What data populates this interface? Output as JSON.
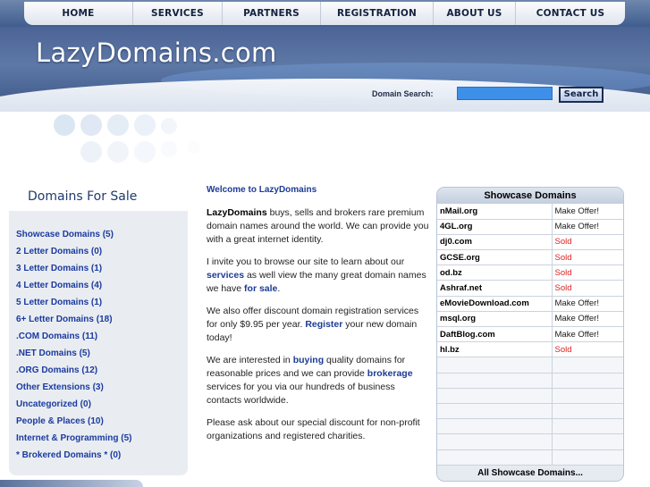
{
  "nav": {
    "items": [
      "HOME",
      "SERVICES",
      "PARTNERS",
      "REGISTRATION",
      "ABOUT US",
      "CONTACT US"
    ]
  },
  "header": {
    "logo": "LazyDomains.com",
    "search_label": "Domain Search:",
    "search_value": "",
    "search_button": "Search"
  },
  "sidebar": {
    "title": "Domains For Sale",
    "items": [
      "Showcase Domains (5)",
      "2 Letter Domains (0)",
      "3 Letter Domains (1)",
      "4 Letter Domains (4)",
      "5 Letter Domains (1)",
      "6+ Letter Domains (18)",
      ".COM Domains (11)",
      ".NET Domains (5)",
      ".ORG Domains (12)",
      "Other Extensions (3)",
      "Uncategorized (0)",
      "People & Places (10)",
      "Internet & Programming (5)",
      "* Brokered Domains * (0)"
    ]
  },
  "content": {
    "welcome": "Welcome to LazyDomains",
    "p1_bold": "LazyDomains",
    "p1_text": " buys, sells and brokers rare premium domain names around the world. We can provide you with a great internet identity.",
    "p2_a": "I invite you to browse our site to learn about our ",
    "p2_link1": "services",
    "p2_b": " as well view the many great domain names we have ",
    "p2_link2": "for sale",
    "p2_c": ".",
    "p3_a": "We also offer discount domain registration services for only $9.95 per year. ",
    "p3_link": "Register",
    "p3_b": " your new domain today!",
    "p4_a": "We are interested in ",
    "p4_link1": "buying",
    "p4_b": " quality domains for reasonable prices and we can provide ",
    "p4_link2": "brokerage",
    "p4_c": " services for you via our hundreds of business contacts worldwide.",
    "p5": "Please ask about our special discount for non-profit organizations and registered charities."
  },
  "showcase": {
    "title": "Showcase Domains",
    "rows": [
      {
        "name": "nMail.org",
        "status": "Make Offer!"
      },
      {
        "name": "4GL.org",
        "status": "Make Offer!"
      },
      {
        "name": "dj0.com",
        "status": "Sold"
      },
      {
        "name": "GCSE.org",
        "status": "Sold"
      },
      {
        "name": "od.bz",
        "status": "Sold"
      },
      {
        "name": "Ashraf.net",
        "status": "Sold"
      },
      {
        "name": "eMovieDownload.com",
        "status": "Make Offer!"
      },
      {
        "name": "msql.org",
        "status": "Make Offer!"
      },
      {
        "name": "DaftBlog.com",
        "status": "Make Offer!"
      },
      {
        "name": "hl.bz",
        "status": "Sold"
      }
    ],
    "footer": "All Showcase Domains...",
    "sold_color": "#dd2222"
  }
}
